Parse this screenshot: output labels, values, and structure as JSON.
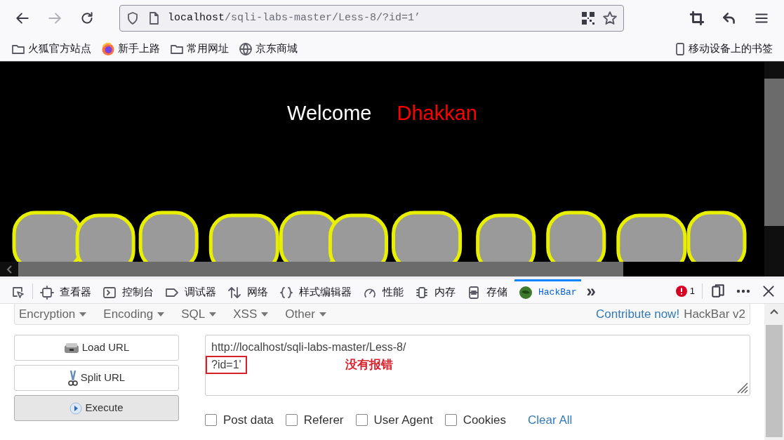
{
  "toolbar": {
    "url_host": "localhost",
    "url_path": "/sqli-labs-master/Less-8/?id=1’"
  },
  "bookmarks": [
    {
      "kind": "folder",
      "label": "火狐官方站点"
    },
    {
      "kind": "firefox",
      "label": "新手上路"
    },
    {
      "kind": "folder",
      "label": "常用网址"
    },
    {
      "kind": "globe",
      "label": "京东商城"
    }
  ],
  "mobile_bookmarks": "移动设备上的书签",
  "page": {
    "welcome": "Welcome",
    "name": "Dhakkan"
  },
  "devtools": {
    "tabs": [
      {
        "selected": false
      },
      {
        "label": "查看器",
        "selected": false
      },
      {
        "label": "控制台",
        "selected": false
      },
      {
        "label": "调试器",
        "selected": false
      },
      {
        "label": "网络",
        "selected": false
      },
      {
        "label": "样式编辑器",
        "selected": false
      },
      {
        "label": "性能",
        "selected": false
      },
      {
        "label": "内存",
        "selected": false
      },
      {
        "label": "存储",
        "selected": false
      },
      {
        "label": "HackBar",
        "selected": true
      }
    ],
    "overflow": "»",
    "error_count": "1"
  },
  "hackbar": {
    "menus": [
      "Encryption",
      "Encoding",
      "SQL",
      "XSS",
      "Other"
    ],
    "contribute": "Contribute now!",
    "version": "HackBar v2",
    "buttons": [
      {
        "label": "Load URL",
        "selected": false
      },
      {
        "label": "Split URL",
        "selected": false
      },
      {
        "label": "Execute",
        "selected": true
      }
    ],
    "url_line1": "http://localhost/sqli-labs-master/Less-8/",
    "url_line2": "?id=1'",
    "note": "没有报错",
    "options": [
      {
        "label": "Post data",
        "checked": false
      },
      {
        "label": "Referer",
        "checked": false
      },
      {
        "label": "User Agent",
        "checked": false
      },
      {
        "label": "Cookies",
        "checked": false
      }
    ],
    "clear": "Clear All"
  }
}
